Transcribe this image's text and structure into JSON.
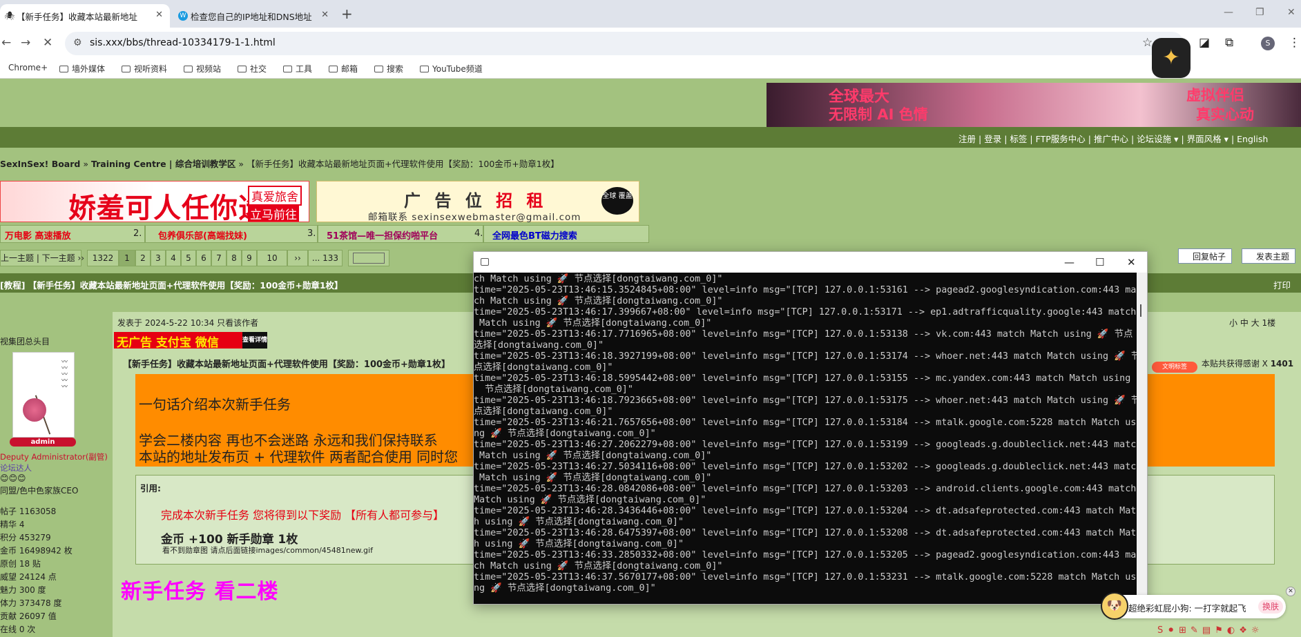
{
  "browser": {
    "tabs": [
      {
        "title": "【新手任务】收藏本站最新地址",
        "favicon": "spider-icon"
      },
      {
        "title": "检查您自己的IP地址和DNS地址",
        "favicon": "w-icon"
      }
    ],
    "new_tab": "+",
    "url": "sis.xxx/bbs/thread-10334179-1-1.html",
    "bookmarks": [
      "Chrome+",
      "墙外媒体",
      "视听资料",
      "视频站",
      "社交",
      "工具",
      "邮箱",
      "搜索",
      "YouTube频道"
    ],
    "profile_initial": "S"
  },
  "forum": {
    "top_banner": {
      "line1": "全球最大",
      "line2": "无限制 AI 色情",
      "line3": "虚拟伴侣",
      "line4": "真实心动"
    },
    "user_links": [
      "注册",
      "登录",
      "标签",
      "FTP服务中心",
      "推广中心",
      "论坛设施",
      "界面风格",
      "English"
    ],
    "breadcrumb": {
      "board": "SexInSex! Board",
      "sep1": "»",
      "forum": "Training Centre | 综合培训教学区",
      "sep2": "»",
      "thread": "【新手任务】收藏本站最新地址页面+代理软件使用【奖励：100金币+勋章1枚】"
    },
    "ad1": {
      "big": "娇羞可人任你选",
      "tag1": "真爱旅舍",
      "tag2": "立马前往"
    },
    "ad2": {
      "title_a": "广 告 位 ",
      "title_b": "招 租",
      "mail": "邮箱联系  sexinsexwebmaster@gmail.com",
      "bubble": "全球 覆盖"
    },
    "link_row": [
      {
        "num": "",
        "text": "万电影 高速播放",
        "color": "#e60012"
      },
      {
        "num": "2.",
        "text": "包养俱乐部(高端找妹)",
        "color": "#e60012"
      },
      {
        "num": "3.",
        "text": "51茶馆—唯一担保约啪平台",
        "color": "#a0005a"
      },
      {
        "num": "4.",
        "text": "全网最色BT磁力搜索",
        "color": "#0000cc"
      }
    ],
    "pager": {
      "prevnext": "上一主题 | 下一主题 ››",
      "total": "1322",
      "pages": [
        "1",
        "2",
        "3",
        "4",
        "5",
        "6",
        "7",
        "8",
        "9",
        "10"
      ],
      "next": "››",
      "last": "... 133"
    },
    "reply_buttons": [
      "回复帖子",
      "发表主题"
    ],
    "thread_title": "[教程] 【新手任务】收藏本站最新地址页面+代理软件使用【奖励：100金币+勋章1枚】",
    "print": "打印",
    "author": {
      "group": "视集团总头目",
      "badge": "admin",
      "title": "Deputy Administrator(副管)",
      "extra1": "论坛达人",
      "extra2": "同盟/色中色家族CEO",
      "stats": [
        "帖子 1163058",
        "精华 4",
        "积分 453279",
        "金币 16498942 枚",
        "原创 18 贴",
        "威望 24124 点",
        "魅力 300 度",
        "体力 373478 度",
        "贡献 26097 值",
        "在线 0 次"
      ]
    },
    "post": {
      "posted": "发表于 2024-5-22 10:34  只看该作者",
      "font_size": "小 中 大  1楼",
      "alipay_banner": "无广告 支付宝 微信",
      "alipay_tag": "查看详情",
      "title": "【新手任务】收藏本站最新地址页面+代理软件使用【奖励：100金币+勋章1枚】",
      "thanks": "本贴共获得感谢 X ",
      "thanks_count": "1401",
      "thanks_badge": "文明标签",
      "orange_lines": [
        "一句话介绍本次新手任务",
        "学会二楼内容  再也不会迷路 永远和我们保持联系",
        "本站的地址发布页 +  代理软件   两者配合使用  同时您"
      ],
      "quote_label": "引用:",
      "quote_red": "完成本次新手任务  您将得到以下奖励  【所有人都可参与】",
      "quote_reward": "金币 +100     新手勋章 1枚",
      "quote_note": "看不到勋章图 请点后面链接images/common/45481new.gif",
      "big_pink": "新手任务  看二楼"
    }
  },
  "terminal": {
    "lines": [
      "ch Match using 🚀 节点选择[dongtaiwang.com_0]\"",
      "time=\"2025-05-23T13:46:15.3524845+08:00\" level=info msg=\"[TCP] 127.0.0.1:53161 --> pagead2.googlesyndication.com:443 mat",
      "ch Match using 🚀 节点选择[dongtaiwang.com_0]\"",
      "time=\"2025-05-23T13:46:17.399667+08:00\" level=info msg=\"[TCP] 127.0.0.1:53171 --> ep1.adtrafficquality.google:443 match",
      " Match using 🚀 节点选择[dongtaiwang.com_0]\"",
      "time=\"2025-05-23T13:46:17.7716965+08:00\" level=info msg=\"[TCP] 127.0.0.1:53138 --> vk.com:443 match Match using 🚀 节点",
      "选择[dongtaiwang.com_0]\"",
      "time=\"2025-05-23T13:46:18.3927199+08:00\" level=info msg=\"[TCP] 127.0.0.1:53174 --> whoer.net:443 match Match using 🚀 节",
      "点选择[dongtaiwang.com_0]\"",
      "time=\"2025-05-23T13:46:18.5995442+08:00\" level=info msg=\"[TCP] 127.0.0.1:53155 --> mc.yandex.com:443 match Match using",
      "  节点选择[dongtaiwang.com_0]\"",
      "time=\"2025-05-23T13:46:18.7923665+08:00\" level=info msg=\"[TCP] 127.0.0.1:53175 --> whoer.net:443 match Match using 🚀 节",
      "点选择[dongtaiwang.com_0]\"",
      "time=\"2025-05-23T13:46:21.7657656+08:00\" level=info msg=\"[TCP] 127.0.0.1:53184 --> mtalk.google.com:5228 match Match usi",
      "ng 🚀 节点选择[dongtaiwang.com_0]\"",
      "time=\"2025-05-23T13:46:27.2062279+08:00\" level=info msg=\"[TCP] 127.0.0.1:53199 --> googleads.g.doubleclick.net:443 match",
      " Match using 🚀 节点选择[dongtaiwang.com_0]\"",
      "time=\"2025-05-23T13:46:27.5034116+08:00\" level=info msg=\"[TCP] 127.0.0.1:53202 --> googleads.g.doubleclick.net:443 match",
      " Match using 🚀 节点选择[dongtaiwang.com_0]\"",
      "time=\"2025-05-23T13:46:28.0842086+08:00\" level=info msg=\"[TCP] 127.0.0.1:53203 --> android.clients.google.com:443 match",
      "Match using 🚀 节点选择[dongtaiwang.com_0]\"",
      "time=\"2025-05-23T13:46:28.3436446+08:00\" level=info msg=\"[TCP] 127.0.0.1:53204 --> dt.adsafeprotected.com:443 match Matc",
      "h using 🚀 节点选择[dongtaiwang.com_0]\"",
      "time=\"2025-05-23T13:46:28.6475397+08:00\" level=info msg=\"[TCP] 127.0.0.1:53208 --> dt.adsafeprotected.com:443 match Matc",
      "h using 🚀 节点选择[dongtaiwang.com_0]\"",
      "time=\"2025-05-23T13:46:33.2850332+08:00\" level=info msg=\"[TCP] 127.0.0.1:53205 --> pagead2.googlesyndication.com:443 mat",
      "ch Match using 🚀 节点选择[dongtaiwang.com_0]\"",
      "time=\"2025-05-23T13:46:37.5670177+08:00\" level=info msg=\"[TCP] 127.0.0.1:53231 --> mtalk.google.com:5228 match Match usi",
      "ng 🚀 节点选择[dongtaiwang.com_0]\""
    ]
  },
  "ime": {
    "text": "超绝彩虹屁小狗: 一打字就起飞",
    "switch": "换肤"
  }
}
